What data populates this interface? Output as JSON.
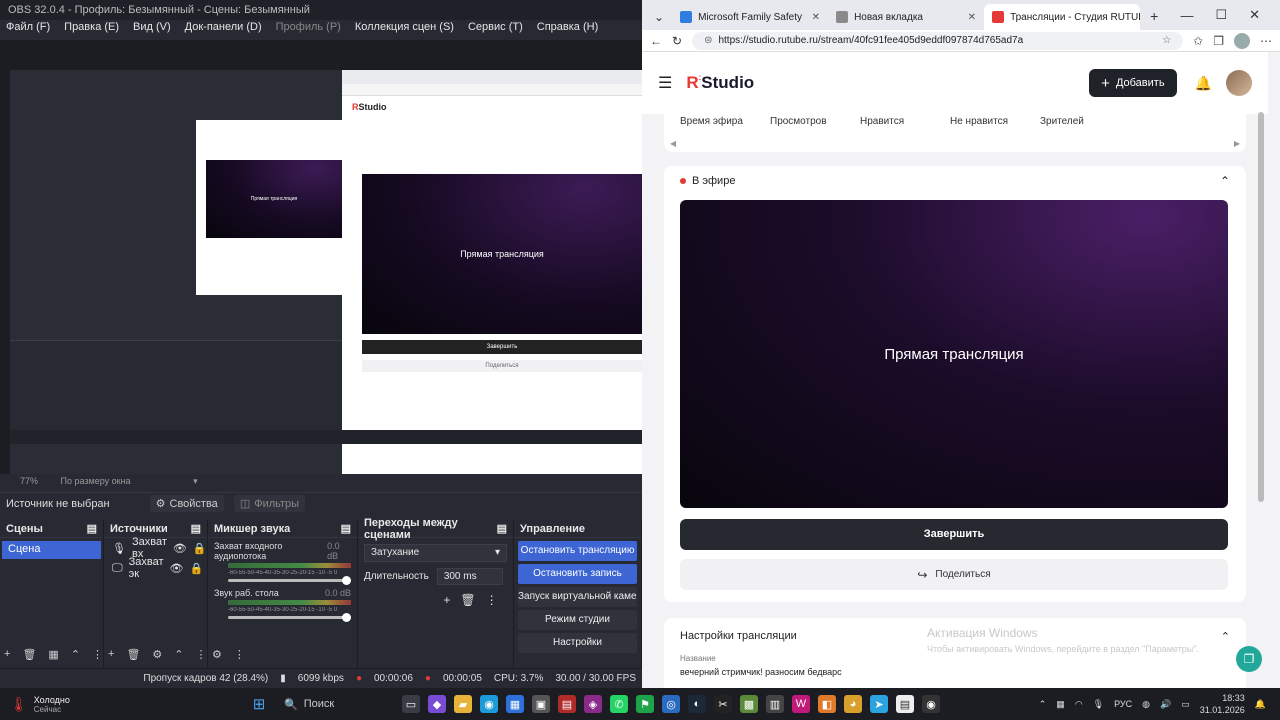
{
  "obs": {
    "title": "OBS 32.0.4 - Профиль: Безымянный - Сцены: Безымянный",
    "menu": [
      "Файл (F)",
      "Правка (E)",
      "Вид (V)",
      "Док-панели (D)",
      "Профиль (P)",
      "Коллекция сцен (S)",
      "Сервис (T)",
      "Справка (H)"
    ],
    "preview_video_text": "Прямая трансляция",
    "preview_end_label": "Завершить",
    "preview_share_label": "Поделиться",
    "zoom_label": "77%",
    "zoom_mode": "По размеру окна",
    "source_bar": {
      "status": "Источник не выбран",
      "properties": "Свойства",
      "filters": "Фильтры"
    },
    "scenes": {
      "title": "Сцены",
      "items": [
        "Сцена"
      ]
    },
    "sources": {
      "title": "Источники",
      "items": [
        "Захват вх",
        "Захват эк"
      ]
    },
    "mixer": {
      "title": "Микшер звука",
      "scale": "-60-55-50-45-40-35-30-25-20-15 -10 -5 0",
      "channels": [
        {
          "name": "Захват входного аудиопотока",
          "db": "0.0 dB"
        },
        {
          "name": "Звук раб. стола",
          "db": "0.0 dB"
        }
      ]
    },
    "transitions": {
      "title": "Переходы между сценами",
      "type": "Затухание",
      "duration_label": "Длительность",
      "duration": "300 ms"
    },
    "controls": {
      "title": "Управление",
      "buttons": [
        "Остановить трансляцию",
        "Остановить запись",
        "Запуск виртуальной камеры",
        "Режим студии",
        "Настройки"
      ]
    },
    "status": {
      "dropped": "Пропуск кадров 42 (28.4%)",
      "bitrate": "6099 kbps",
      "stream_time": "00:00:06",
      "record_time": "00:00:05",
      "cpu": "CPU: 3.7%",
      "fps": "30.00 / 30.00 FPS"
    }
  },
  "browser": {
    "tabs": [
      {
        "label": "Microsoft Family Safety",
        "color": "#2f7de1"
      },
      {
        "label": "Новая вкладка",
        "color": "#8a8a8a"
      },
      {
        "label": "Трансляции - Студия RUTUBE",
        "color": "#e53935"
      }
    ],
    "url": "https://studio.rutube.ru/stream/40fc91fee405d9eddf097874d765ad7a"
  },
  "studio": {
    "logo_r": "R",
    "logo_text": "Studio",
    "add_label": "Добавить",
    "stats_columns": [
      "Время эфира",
      "Просмотров",
      "Нравится",
      "Не нравится",
      "Зрителей"
    ],
    "live_label": "В эфире",
    "video_text": "Прямая трансляция",
    "end_label": "Завершить",
    "share_label": "Поделиться",
    "settings_title": "Настройки трансляции",
    "name_label": "Название",
    "name_value": "вечерний стримчик! разносим бедварс",
    "activation_title": "Активация Windows",
    "activation_sub": "Чтобы активировать Windows, перейдите в раздел \"Параметры\"."
  },
  "taskbar": {
    "weather_title": "Холодно",
    "weather_sub": "Сейчас",
    "search_label": "Поиск",
    "lang": "РУС",
    "time": "18:33",
    "date": "31.01.2026"
  }
}
